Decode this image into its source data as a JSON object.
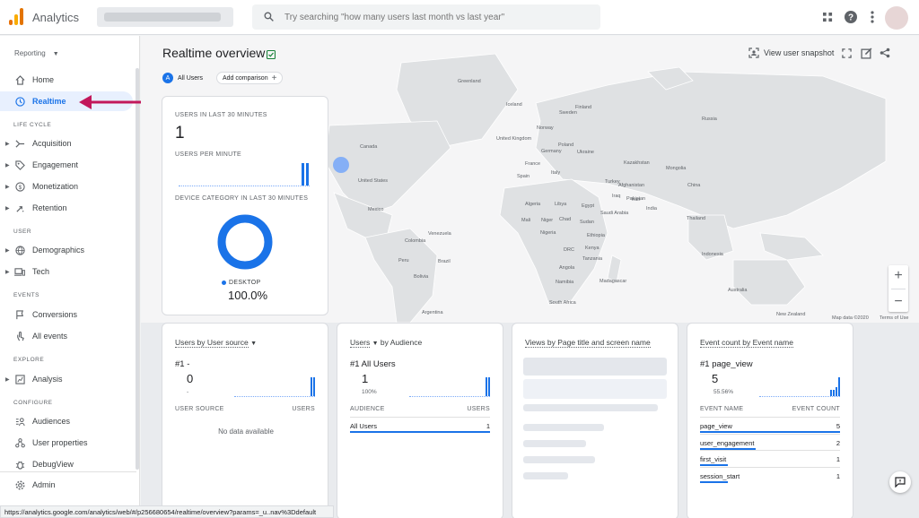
{
  "app": {
    "name": "Analytics"
  },
  "search": {
    "placeholder": "Try searching \"how many users last month vs last year\""
  },
  "sidebar": {
    "reporting": "Reporting",
    "top": [
      {
        "label": "Home"
      },
      {
        "label": "Realtime"
      }
    ],
    "sections": [
      {
        "title": "LIFE CYCLE",
        "items": [
          {
            "label": "Acquisition"
          },
          {
            "label": "Engagement"
          },
          {
            "label": "Monetization"
          },
          {
            "label": "Retention"
          }
        ]
      },
      {
        "title": "USER",
        "items": [
          {
            "label": "Demographics"
          },
          {
            "label": "Tech"
          }
        ]
      },
      {
        "title": "EVENTS",
        "items": [
          {
            "label": "Conversions"
          },
          {
            "label": "All events"
          }
        ]
      },
      {
        "title": "EXPLORE",
        "items": [
          {
            "label": "Analysis"
          }
        ]
      },
      {
        "title": "CONFIGURE",
        "items": [
          {
            "label": "Audiences"
          },
          {
            "label": "User properties"
          },
          {
            "label": "DebugView"
          }
        ]
      }
    ],
    "admin": "Admin"
  },
  "status_url": "https://analytics.google.com/analytics/web/#/p256680654/realtime/overview?params=_u..nav%3Ddefault",
  "header": {
    "title": "Realtime overview",
    "all_users_letter": "A",
    "all_users": "All Users",
    "add_comparison": "Add comparison",
    "view_snapshot": "View user snapshot"
  },
  "map": {
    "labels": [
      "Greenland",
      "Canada",
      "United States",
      "Mexico",
      "Colombia",
      "Venezuela",
      "Peru",
      "Brazil",
      "Bolivia",
      "Argentina",
      "Iceland",
      "Sweden",
      "Finland",
      "Norway",
      "United Kingdom",
      "Poland",
      "Ukraine",
      "Germany",
      "France",
      "Spain",
      "Italy",
      "Turkey",
      "Iraq",
      "Iran",
      "Algeria",
      "Libya",
      "Egypt",
      "Mali",
      "Niger",
      "Chad",
      "Sudan",
      "Nigeria",
      "Ethiopia",
      "DRC",
      "Kenya",
      "Tanzania",
      "Angola",
      "Namibia",
      "Madagascar",
      "South Africa",
      "Russia",
      "Kazakhstan",
      "Mongolia",
      "China",
      "Afghanistan",
      "Pakistan",
      "India",
      "Saudi Arabia",
      "Thailand",
      "Indonesia",
      "Australia",
      "New Zealand"
    ],
    "attribution": "Map data ©2020",
    "terms": "Terms of Use"
  },
  "overview_card": {
    "users_label": "USERS IN LAST 30 MINUTES",
    "users_value": "1",
    "per_minute_label": "USERS PER MINUTE",
    "per_minute": [
      0,
      0,
      0,
      0,
      0,
      0,
      0,
      0,
      0,
      0,
      0,
      0,
      0,
      0,
      0,
      0,
      0,
      0,
      0,
      0,
      0,
      0,
      0,
      0,
      0,
      0,
      0,
      0,
      1,
      1
    ],
    "device_label": "DEVICE CATEGORY IN LAST 30 MINUTES",
    "device": "DESKTOP",
    "device_pct": "100.0%",
    "device_fraction": 1.0
  },
  "cards": [
    {
      "title": "Users by User source",
      "rank": "#1  -",
      "value": "0",
      "sub": "-",
      "col1": "USER SOURCE",
      "col2": "USERS",
      "empty": "No data available",
      "rows": [],
      "spark": [
        0,
        0,
        0,
        0,
        0,
        0,
        0,
        0,
        0,
        0,
        0,
        0,
        0,
        0,
        0,
        0,
        0,
        0,
        0,
        0,
        0,
        0,
        0,
        0,
        0,
        0,
        0,
        0,
        1,
        1
      ]
    },
    {
      "title": "Users",
      "title_suffix": "by Audience",
      "rank": "#1  All Users",
      "value": "1",
      "sub": "100%",
      "col1": "AUDIENCE",
      "col2": "USERS",
      "rows": [
        {
          "name": "All Users",
          "value": "1",
          "share": 1.0
        }
      ],
      "spark": [
        0,
        0,
        0,
        0,
        0,
        0,
        0,
        0,
        0,
        0,
        0,
        0,
        0,
        0,
        0,
        0,
        0,
        0,
        0,
        0,
        0,
        0,
        0,
        0,
        0,
        0,
        0,
        0,
        1,
        1
      ]
    },
    {
      "title": "Views by Page title and screen name"
    },
    {
      "title": "Event count by Event name",
      "rank": "#1  page_view",
      "value": "5",
      "sub": "55.56%",
      "col1": "EVENT NAME",
      "col2": "EVENT COUNT",
      "rows": [
        {
          "name": "page_view",
          "value": "5",
          "share": 1.0
        },
        {
          "name": "user_engagement",
          "value": "2",
          "share": 0.4
        },
        {
          "name": "first_visit",
          "value": "1",
          "share": 0.2
        },
        {
          "name": "session_start",
          "value": "1",
          "share": 0.2
        }
      ],
      "spark": [
        0,
        0,
        0,
        0,
        0,
        0,
        0,
        0,
        0,
        0,
        0,
        0,
        0,
        0,
        0,
        0,
        0,
        0,
        0,
        0,
        0,
        0,
        0,
        0,
        0,
        0,
        2,
        2,
        3,
        6
      ]
    }
  ],
  "colors": {
    "accent": "#1a73e8",
    "arrow": "#c2185b",
    "logo": [
      "#f9ab00",
      "#e37400",
      "#e8710a"
    ]
  }
}
